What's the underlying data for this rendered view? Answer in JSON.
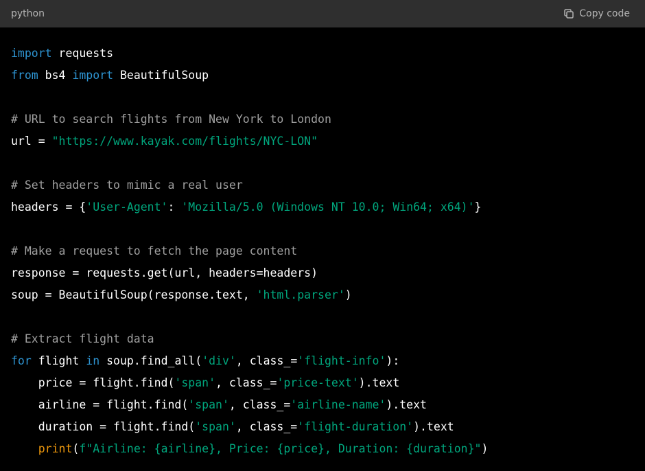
{
  "header": {
    "language": "python",
    "copy_label": "Copy code"
  },
  "colors": {
    "keyword": "#2e95d3",
    "string": "#00a67d",
    "comment": "#a0a0a0",
    "builtin": "#e9950c",
    "text": "#ffffff",
    "header_bg": "#2f2f2f",
    "code_bg": "#000000"
  },
  "icons": {
    "copy": "copy-icon"
  },
  "code": [
    [
      {
        "t": "import",
        "c": "kw"
      },
      {
        "t": " requests",
        "c": "id"
      }
    ],
    [
      {
        "t": "from",
        "c": "kw"
      },
      {
        "t": " bs4 ",
        "c": "id"
      },
      {
        "t": "import",
        "c": "kw"
      },
      {
        "t": " BeautifulSoup",
        "c": "id"
      }
    ],
    [],
    [
      {
        "t": "# URL to search flights from New York to London",
        "c": "cm"
      }
    ],
    [
      {
        "t": "url = ",
        "c": "id"
      },
      {
        "t": "\"https://www.kayak.com/flights/NYC-LON\"",
        "c": "str"
      }
    ],
    [],
    [
      {
        "t": "# Set headers to mimic a real user",
        "c": "cm"
      }
    ],
    [
      {
        "t": "headers = {",
        "c": "id"
      },
      {
        "t": "'User-Agent'",
        "c": "str"
      },
      {
        "t": ": ",
        "c": "id"
      },
      {
        "t": "'Mozilla/5.0 (Windows NT 10.0; Win64; x64)'",
        "c": "str"
      },
      {
        "t": "}",
        "c": "id"
      }
    ],
    [],
    [
      {
        "t": "# Make a request to fetch the page content",
        "c": "cm"
      }
    ],
    [
      {
        "t": "response = requests.get(url, headers=headers)",
        "c": "id"
      }
    ],
    [
      {
        "t": "soup = BeautifulSoup(response.text, ",
        "c": "id"
      },
      {
        "t": "'html.parser'",
        "c": "str"
      },
      {
        "t": ")",
        "c": "id"
      }
    ],
    [],
    [
      {
        "t": "# Extract flight data",
        "c": "cm"
      }
    ],
    [
      {
        "t": "for",
        "c": "kw"
      },
      {
        "t": " flight ",
        "c": "id"
      },
      {
        "t": "in",
        "c": "kw"
      },
      {
        "t": " soup.find_all(",
        "c": "id"
      },
      {
        "t": "'div'",
        "c": "str"
      },
      {
        "t": ", class_=",
        "c": "id"
      },
      {
        "t": "'flight-info'",
        "c": "str"
      },
      {
        "t": "):",
        "c": "id"
      }
    ],
    [
      {
        "t": "    price = flight.find(",
        "c": "id"
      },
      {
        "t": "'span'",
        "c": "str"
      },
      {
        "t": ", class_=",
        "c": "id"
      },
      {
        "t": "'price-text'",
        "c": "str"
      },
      {
        "t": ").text",
        "c": "id"
      }
    ],
    [
      {
        "t": "    airline = flight.find(",
        "c": "id"
      },
      {
        "t": "'span'",
        "c": "str"
      },
      {
        "t": ", class_=",
        "c": "id"
      },
      {
        "t": "'airline-name'",
        "c": "str"
      },
      {
        "t": ").text",
        "c": "id"
      }
    ],
    [
      {
        "t": "    duration = flight.find(",
        "c": "id"
      },
      {
        "t": "'span'",
        "c": "str"
      },
      {
        "t": ", class_=",
        "c": "id"
      },
      {
        "t": "'flight-duration'",
        "c": "str"
      },
      {
        "t": ").text",
        "c": "id"
      }
    ],
    [
      {
        "t": "    ",
        "c": "id"
      },
      {
        "t": "print",
        "c": "fn"
      },
      {
        "t": "(",
        "c": "id"
      },
      {
        "t": "f\"Airline: {airline}, Price: {price}, Duration: {duration}\"",
        "c": "str"
      },
      {
        "t": ")",
        "c": "id"
      }
    ]
  ]
}
